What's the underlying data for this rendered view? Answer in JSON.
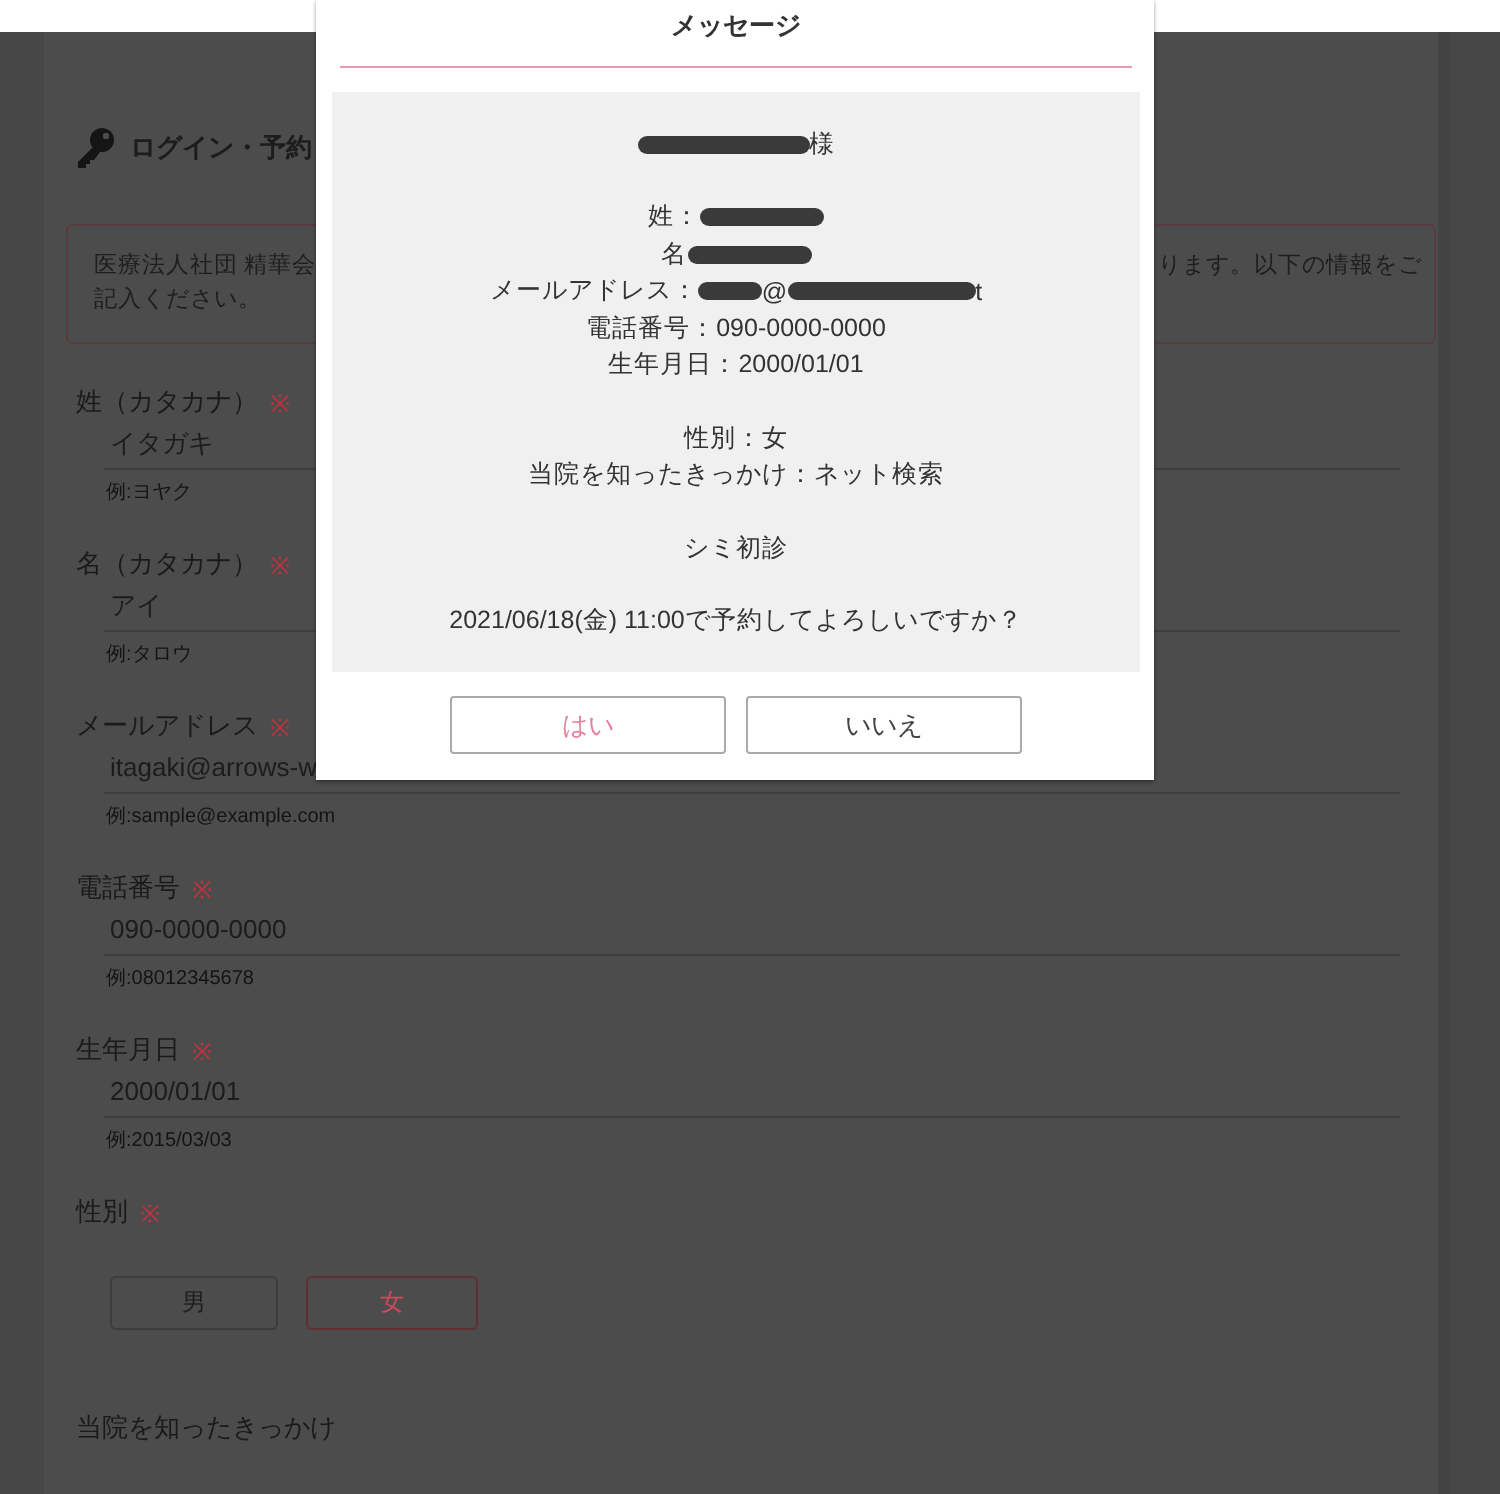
{
  "page": {
    "heading": "ログイン・予約",
    "notice": {
      "left_lines": [
        "医療法人社団 精華会",
        "記入ください。"
      ],
      "right_text": "ります。以下の情報をご"
    },
    "fields": [
      {
        "label": "姓（カタカナ）",
        "required_mark": "※",
        "value": "イタガキ",
        "hint": "例:ヨヤク"
      },
      {
        "label": "名（カタカナ）",
        "required_mark": "※",
        "value": "アイ",
        "hint": "例:タロウ"
      },
      {
        "label": "メールアドレス",
        "required_mark": "※",
        "value": "itagaki@arrows-w",
        "hint": "例:sample@example.com"
      },
      {
        "label": "電話番号",
        "required_mark": "※",
        "value": "090-0000-0000",
        "hint": "例:08012345678"
      },
      {
        "label": "生年月日",
        "required_mark": "※",
        "value": "2000/01/01",
        "hint": "例:2015/03/03"
      }
    ],
    "gender": {
      "label": "性別",
      "required_mark": "※",
      "options": [
        {
          "label": "男",
          "selected": false
        },
        {
          "label": "女",
          "selected": true
        }
      ]
    },
    "referral_label": "当院を知ったきっかけ"
  },
  "dialog": {
    "title": "メッセージ",
    "paragraphs": [
      [
        [
          {
            "kind": "redacted"
          },
          {
            "kind": "text",
            "text": "様"
          }
        ]
      ],
      [
        [
          {
            "kind": "text",
            "text": "姓："
          },
          {
            "kind": "redacted"
          }
        ],
        [
          {
            "kind": "text",
            "text": "名"
          },
          {
            "kind": "redacted"
          }
        ],
        [
          {
            "kind": "text",
            "text": "メールアドレス："
          },
          {
            "kind": "redacted"
          },
          {
            "kind": "text",
            "text": "@"
          },
          {
            "kind": "redacted"
          },
          {
            "kind": "text",
            "text": "t"
          }
        ],
        [
          {
            "kind": "text",
            "text": "電話番号：090-0000-0000"
          }
        ],
        [
          {
            "kind": "text",
            "text": "生年月日：2000/01/01"
          }
        ]
      ],
      [
        [
          {
            "kind": "text",
            "text": "性別：女"
          }
        ],
        [
          {
            "kind": "text",
            "text": "当院を知ったきっかけ：ネット検索"
          }
        ]
      ],
      [
        [
          {
            "kind": "text",
            "text": "シミ初診"
          }
        ]
      ],
      [
        [
          {
            "kind": "text",
            "text": "2021/06/18(金) 11:00で予約してよろしいですか？"
          }
        ]
      ]
    ],
    "buttons": [
      {
        "label": "はい",
        "kind": "primary"
      },
      {
        "label": "いいえ",
        "kind": "secondary"
      }
    ]
  }
}
